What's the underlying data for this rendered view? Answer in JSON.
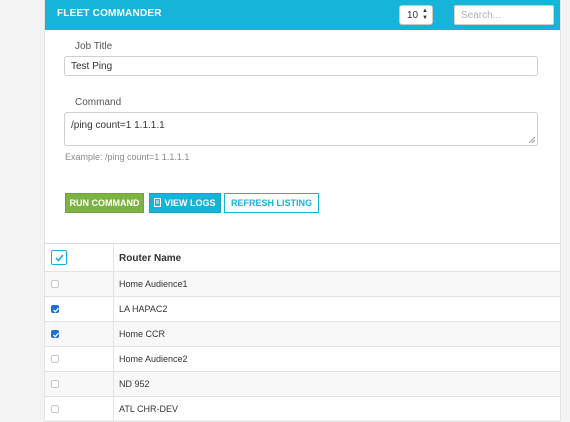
{
  "header": {
    "title": "FLEET COMMANDER",
    "page_size": "10",
    "search_placeholder": "Search..."
  },
  "form": {
    "job_title_label": "Job Title",
    "job_title_value": "Test Ping",
    "command_label": "Command",
    "command_value": "/ping count=1 1.1.1.1",
    "example_text": "Example: /ping count=1 1.1.1.1"
  },
  "buttons": {
    "run": "RUN COMMAND",
    "logs": "VIEW LOGS",
    "refresh": "REFRESH LISTING"
  },
  "table": {
    "header": "Router Name",
    "rows": [
      {
        "name": "Home Audience1",
        "checked": false
      },
      {
        "name": "LA HAPAC2",
        "checked": true
      },
      {
        "name": "Home CCR",
        "checked": true
      },
      {
        "name": "Home Audience2",
        "checked": false
      },
      {
        "name": "ND 952",
        "checked": false
      },
      {
        "name": "ATL CHR-DEV",
        "checked": false
      }
    ]
  },
  "colors": {
    "accent": "#16b4d8",
    "run_button": "#7cb342",
    "checkbox_checked": "#1e6fd9"
  }
}
